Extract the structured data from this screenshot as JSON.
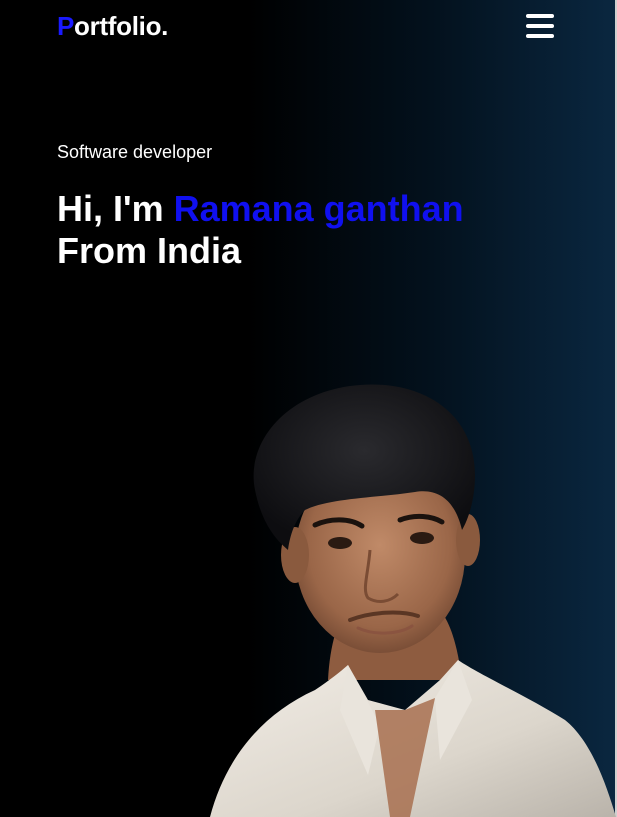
{
  "header": {
    "logo_first": "P",
    "logo_rest": "ortfolio.",
    "menu_icon": "hamburger-menu-icon"
  },
  "hero": {
    "subtitle": "Software developer",
    "greeting": "Hi, I'm ",
    "name": "Ramana ganthan",
    "origin": "From India"
  },
  "colors": {
    "accent": "#1010f0",
    "background_dark": "#000000",
    "background_light": "#0a2740",
    "text": "#ffffff"
  }
}
